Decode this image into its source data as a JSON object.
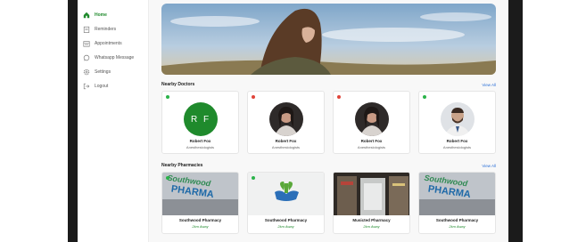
{
  "sidebar": {
    "items": [
      {
        "label": "Home",
        "icon": "home-icon",
        "active": true
      },
      {
        "label": "Reminders",
        "icon": "clipboard-icon",
        "active": false
      },
      {
        "label": "Appointments",
        "icon": "calendar-icon",
        "active": false
      },
      {
        "label": "Whatsapp Message",
        "icon": "whatsapp-icon",
        "active": false
      },
      {
        "label": "Settings",
        "icon": "gear-icon",
        "active": false
      },
      {
        "label": "Logout",
        "icon": "logout-icon",
        "active": false
      }
    ]
  },
  "doctors": {
    "title": "Nearby Doctors",
    "view_all": "View All",
    "items": [
      {
        "name": "Robert Fox",
        "role": "Anesthesiologists",
        "status": "online",
        "initials": "R F"
      },
      {
        "name": "Robert Fox",
        "role": "Anesthesiologists",
        "status": "offline"
      },
      {
        "name": "Robert Fox",
        "role": "Anesthesiologists",
        "status": "offline"
      },
      {
        "name": "Robert Fox",
        "role": "Anesthesiologists",
        "status": "online"
      }
    ]
  },
  "pharmacies": {
    "title": "Nearby Pharmacies",
    "view_all": "View All",
    "items": [
      {
        "name": "Southwood Pharmacy",
        "distance": "2km Away",
        "sign_text": "Southwood PHARMA"
      },
      {
        "name": "Southwood Pharmacy",
        "distance": "2km Away"
      },
      {
        "name": "Musicted Pharmacy",
        "distance": "2km Away"
      },
      {
        "name": "Southwood Pharmacy",
        "distance": "2km Away",
        "sign_text": "Southwood PHARMA"
      }
    ]
  },
  "colors": {
    "accent": "#1f8a2c",
    "online": "#2bb34a",
    "offline": "#e0443a",
    "link": "#2a6fd6"
  }
}
